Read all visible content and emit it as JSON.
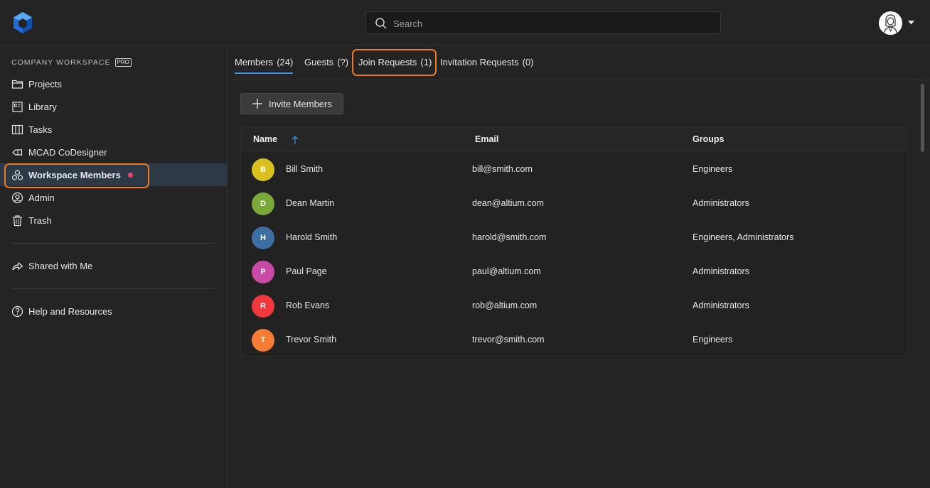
{
  "search": {
    "placeholder": "Search"
  },
  "sidebar": {
    "workspace_label": "COMPANY WORKSPACE",
    "pro_badge": "PRO",
    "items": [
      {
        "label": "Projects",
        "icon": "folder-icon"
      },
      {
        "label": "Library",
        "icon": "library-icon"
      },
      {
        "label": "Tasks",
        "icon": "tasks-icon"
      },
      {
        "label": "MCAD CoDesigner",
        "icon": "mcad-icon"
      },
      {
        "label": "Workspace Members",
        "icon": "members-icon",
        "active": true
      },
      {
        "label": "Admin",
        "icon": "admin-icon"
      },
      {
        "label": "Trash",
        "icon": "trash-icon"
      }
    ],
    "shared": {
      "label": "Shared with Me",
      "icon": "share-icon"
    },
    "help": {
      "label": "Help and Resources",
      "icon": "help-icon"
    }
  },
  "tabs": [
    {
      "label": "Members",
      "count": "(24)",
      "active": true
    },
    {
      "label": "Guests",
      "count": "(?)"
    },
    {
      "label": "Join Requests",
      "count": "(1)"
    },
    {
      "label": "Invitation Requests",
      "count": "(0)"
    }
  ],
  "invite_button": "Invite Members",
  "table": {
    "headers": {
      "name": "Name",
      "email": "Email",
      "groups": "Groups"
    },
    "rows": [
      {
        "initial": "B",
        "color": "#d8c11f",
        "name": "Bill Smith",
        "email": "bill@smith.com",
        "groups": "Engineers"
      },
      {
        "initial": "D",
        "color": "#7aa93a",
        "name": "Dean Martin",
        "email": "dean@altium.com",
        "groups": "Administrators"
      },
      {
        "initial": "H",
        "color": "#3e6fa3",
        "name": "Harold Smith",
        "email": "harold@smith.com",
        "groups": "Engineers, Administrators"
      },
      {
        "initial": "P",
        "color": "#c84aa6",
        "name": "Paul Page",
        "email": "paul@altium.com",
        "groups": "Administrators"
      },
      {
        "initial": "R",
        "color": "#f0383e",
        "name": "Rob Evans",
        "email": "rob@altium.com",
        "groups": "Administrators"
      },
      {
        "initial": "T",
        "color": "#f47c35",
        "name": "Trevor Smith",
        "email": "trevor@smith.com",
        "groups": "Engineers"
      }
    ]
  },
  "colors": {
    "accent": "#3d8fe0",
    "highlight": "#f07a1a",
    "active_dot": "#f0436b"
  }
}
